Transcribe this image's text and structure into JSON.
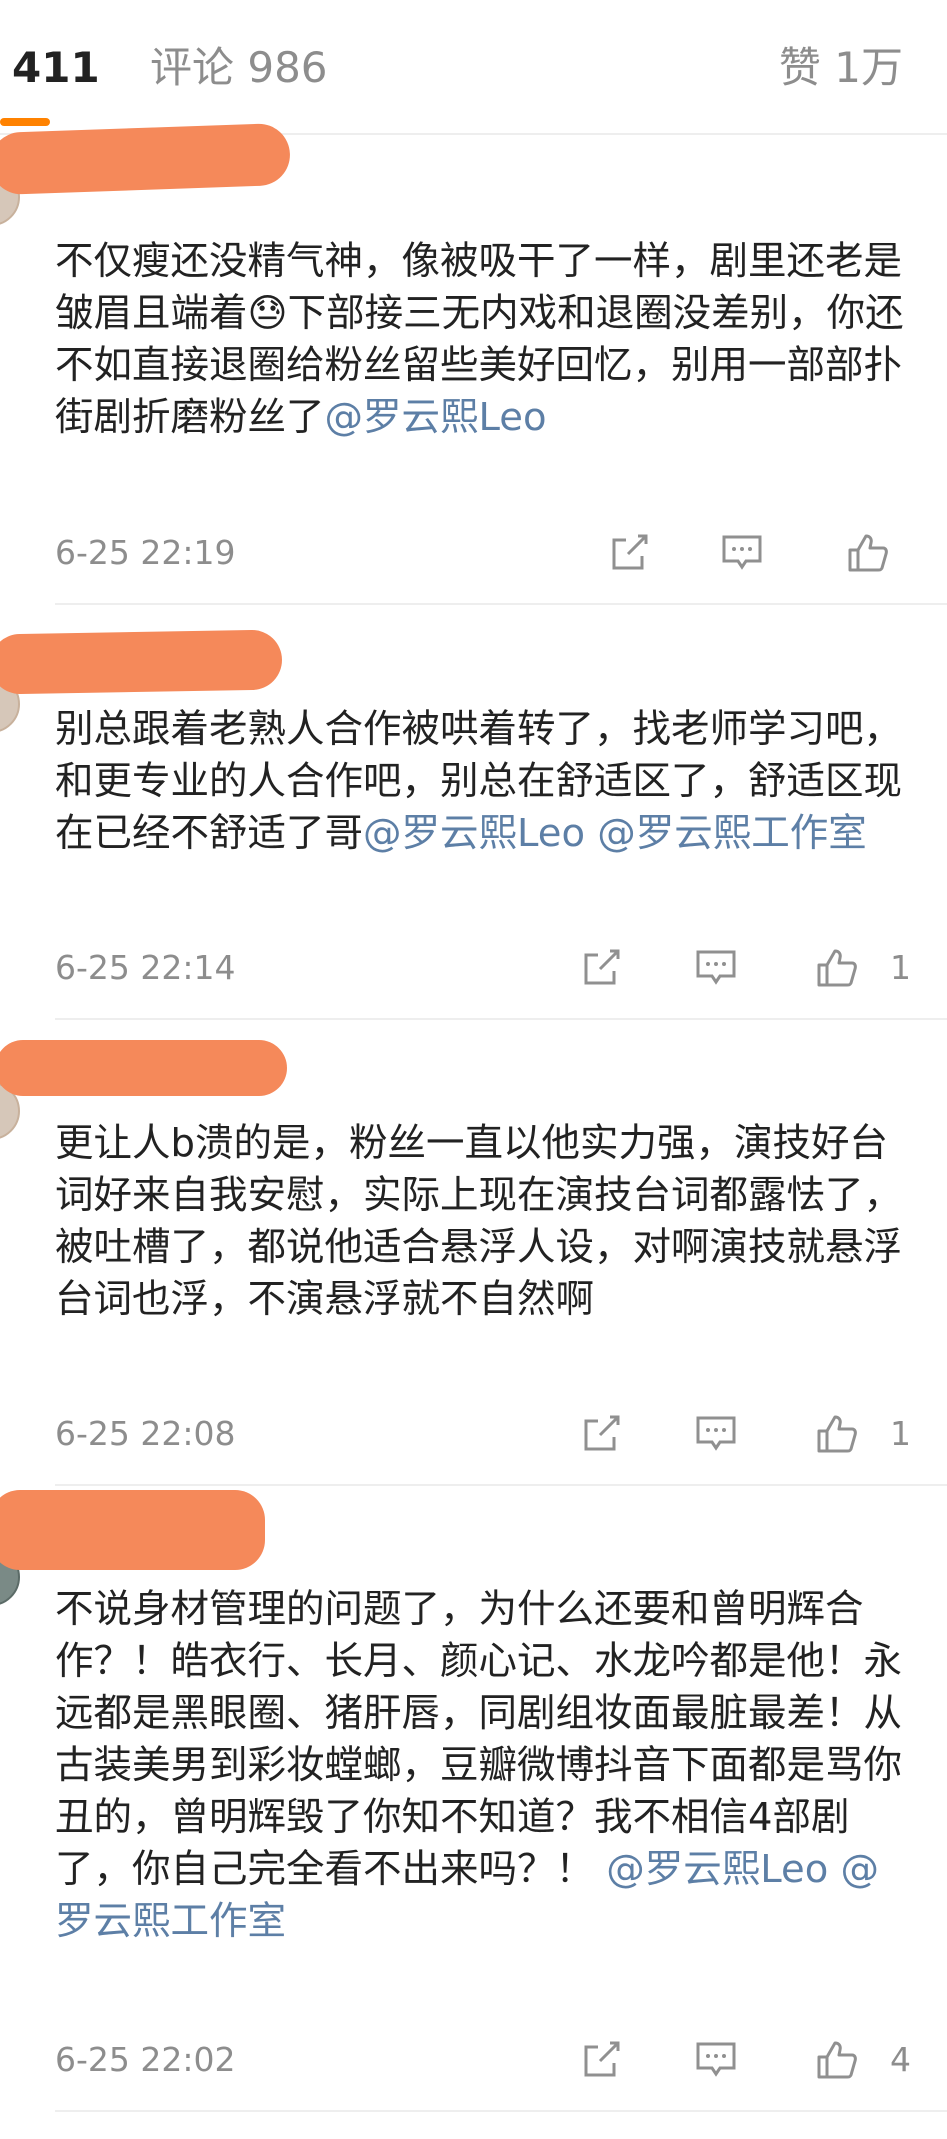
{
  "tabs": {
    "reposts": "411",
    "comments": "评论 986",
    "likes": "赞 1万"
  },
  "comments": [
    {
      "text_parts": [
        "不仅瘦还没精气神，像被吸干了一样，剧里还老是皱眉且端着",
        "😓",
        "下部接三无内戏和退圈没差别，你还不如直接退圈给粉丝留些美好回忆，别用一部部扑街剧折磨粉丝了"
      ],
      "mentions": [
        "@罗云熙Leo"
      ],
      "time": "6-25 22:19",
      "likes": ""
    },
    {
      "text_parts": [
        "别总跟着老熟人合作被哄着转了，找老师学习吧，和更专业的人合作吧，别总在舒适区了，舒适区现在已经不舒适了哥"
      ],
      "mentions": [
        "@罗云熙Leo",
        "@罗云熙工作室"
      ],
      "time": "6-25 22:14",
      "likes": "1"
    },
    {
      "text_parts": [
        "更让人b溃的是，粉丝一直以他实力强，演技好台词好来自我安慰，实际上现在演技台词都露怯了，被吐槽了，都说他适合悬浮人设，对啊演技就悬浮台词也浮，不演悬浮就不自然啊"
      ],
      "mentions": [],
      "time": "6-25 22:08",
      "likes": "1"
    },
    {
      "text_parts": [
        "不说身材管理的问题了，为什么还要和曾明辉合作？！皓衣行、长月、颜心记、水龙吟都是他！永远都是黑眼圈、猪肝唇，同剧组妆面最脏最差！从古装美男到彩妆螳螂，豆瓣微博抖音下面都是骂你丑的，曾明辉毁了你知不知道？我不相信4部剧了，你自己完全看不出来吗？！"
      ],
      "mentions": [
        "@罗云熙Leo",
        "@罗云熙工作室"
      ],
      "time": "6-25 22:02",
      "likes": "4"
    }
  ],
  "colors": {
    "accent": "#ff8200",
    "mention": "#5d7fa6",
    "muted": "#8d8d8d",
    "redaction": "#f5895a"
  },
  "icons": [
    "share-icon",
    "comment-icon",
    "thumbs-up-icon"
  ]
}
